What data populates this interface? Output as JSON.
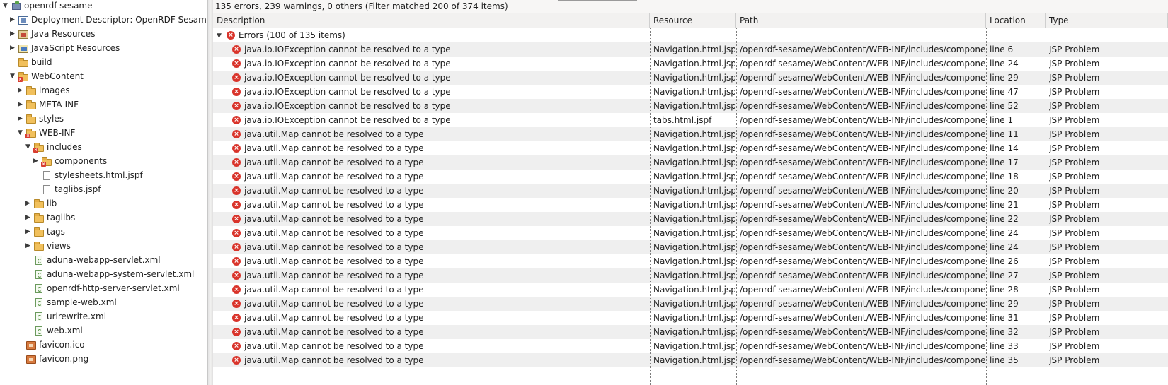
{
  "tree": {
    "items": [
      {
        "label": "openrdf-sesame",
        "icon": "project-icon",
        "toggle": "▼",
        "depth": 0
      },
      {
        "label": "Deployment Descriptor: OpenRDF Sesame",
        "icon": "deployment-descriptor-icon",
        "toggle": "▶",
        "depth": 1
      },
      {
        "label": "Java Resources",
        "icon": "java-resources-icon",
        "toggle": "▶",
        "depth": 1
      },
      {
        "label": "JavaScript Resources",
        "icon": "javascript-resources-icon",
        "toggle": "▶",
        "depth": 1
      },
      {
        "label": "build",
        "icon": "folder-icon",
        "toggle": "",
        "depth": 1
      },
      {
        "label": "WebContent",
        "icon": "folder-error-icon",
        "toggle": "▼",
        "depth": 1
      },
      {
        "label": "images",
        "icon": "folder-icon",
        "toggle": "▶",
        "depth": 2
      },
      {
        "label": "META-INF",
        "icon": "folder-icon",
        "toggle": "▶",
        "depth": 2
      },
      {
        "label": "styles",
        "icon": "folder-icon",
        "toggle": "▶",
        "depth": 2
      },
      {
        "label": "WEB-INF",
        "icon": "folder-error-icon",
        "toggle": "▼",
        "depth": 2
      },
      {
        "label": "includes",
        "icon": "folder-error-icon",
        "toggle": "▼",
        "depth": 3
      },
      {
        "label": "components",
        "icon": "folder-error-icon",
        "toggle": "▶",
        "depth": 4
      },
      {
        "label": "stylesheets.html.jspf",
        "icon": "file-icon",
        "toggle": "",
        "depth": 4
      },
      {
        "label": "taglibs.jspf",
        "icon": "file-icon",
        "toggle": "",
        "depth": 4
      },
      {
        "label": "lib",
        "icon": "folder-icon",
        "toggle": "▶",
        "depth": 3
      },
      {
        "label": "taglibs",
        "icon": "folder-icon",
        "toggle": "▶",
        "depth": 3
      },
      {
        "label": "tags",
        "icon": "folder-icon",
        "toggle": "▶",
        "depth": 3
      },
      {
        "label": "views",
        "icon": "folder-icon",
        "toggle": "▶",
        "depth": 3
      },
      {
        "label": "aduna-webapp-servlet.xml",
        "icon": "xml-file-icon",
        "toggle": "",
        "depth": 3
      },
      {
        "label": "aduna-webapp-system-servlet.xml",
        "icon": "xml-file-icon",
        "toggle": "",
        "depth": 3
      },
      {
        "label": "openrdf-http-server-servlet.xml",
        "icon": "xml-file-icon",
        "toggle": "",
        "depth": 3
      },
      {
        "label": "sample-web.xml",
        "icon": "xml-file-icon",
        "toggle": "",
        "depth": 3
      },
      {
        "label": "urlrewrite.xml",
        "icon": "xml-file-icon",
        "toggle": "",
        "depth": 3
      },
      {
        "label": "web.xml",
        "icon": "xml-file-icon",
        "toggle": "",
        "depth": 3
      },
      {
        "label": "favicon.ico",
        "icon": "image-file-icon",
        "toggle": "",
        "depth": 2
      },
      {
        "label": "favicon.png",
        "icon": "image-file-icon",
        "toggle": "",
        "depth": 2
      }
    ]
  },
  "problems": {
    "summary": "135 errors, 239 warnings, 0 others (Filter matched 200 of 374 items)",
    "columns": [
      "Description",
      "Resource",
      "Path",
      "Location",
      "Type"
    ],
    "group": {
      "toggle": "▼",
      "label": "Errors (100 of 135 items)"
    },
    "rows": [
      {
        "description": "java.io.IOException cannot be resolved to a type",
        "resource": "Navigation.html.jspf",
        "path": "/openrdf-sesame/WebContent/WEB-INF/includes/components",
        "location": "line 6",
        "type": "JSP Problem"
      },
      {
        "description": "java.io.IOException cannot be resolved to a type",
        "resource": "Navigation.html.jspf",
        "path": "/openrdf-sesame/WebContent/WEB-INF/includes/components",
        "location": "line 24",
        "type": "JSP Problem"
      },
      {
        "description": "java.io.IOException cannot be resolved to a type",
        "resource": "Navigation.html.jspf",
        "path": "/openrdf-sesame/WebContent/WEB-INF/includes/components",
        "location": "line 29",
        "type": "JSP Problem"
      },
      {
        "description": "java.io.IOException cannot be resolved to a type",
        "resource": "Navigation.html.jspf",
        "path": "/openrdf-sesame/WebContent/WEB-INF/includes/components",
        "location": "line 47",
        "type": "JSP Problem"
      },
      {
        "description": "java.io.IOException cannot be resolved to a type",
        "resource": "Navigation.html.jspf",
        "path": "/openrdf-sesame/WebContent/WEB-INF/includes/components",
        "location": "line 52",
        "type": "JSP Problem"
      },
      {
        "description": "java.io.IOException cannot be resolved to a type",
        "resource": "tabs.html.jspf",
        "path": "/openrdf-sesame/WebContent/WEB-INF/includes/components",
        "location": "line 1",
        "type": "JSP Problem"
      },
      {
        "description": "java.util.Map cannot be resolved to a type",
        "resource": "Navigation.html.jspf",
        "path": "/openrdf-sesame/WebContent/WEB-INF/includes/components",
        "location": "line 11",
        "type": "JSP Problem"
      },
      {
        "description": "java.util.Map cannot be resolved to a type",
        "resource": "Navigation.html.jspf",
        "path": "/openrdf-sesame/WebContent/WEB-INF/includes/components",
        "location": "line 14",
        "type": "JSP Problem"
      },
      {
        "description": "java.util.Map cannot be resolved to a type",
        "resource": "Navigation.html.jspf",
        "path": "/openrdf-sesame/WebContent/WEB-INF/includes/components",
        "location": "line 17",
        "type": "JSP Problem"
      },
      {
        "description": "java.util.Map cannot be resolved to a type",
        "resource": "Navigation.html.jspf",
        "path": "/openrdf-sesame/WebContent/WEB-INF/includes/components",
        "location": "line 18",
        "type": "JSP Problem"
      },
      {
        "description": "java.util.Map cannot be resolved to a type",
        "resource": "Navigation.html.jspf",
        "path": "/openrdf-sesame/WebContent/WEB-INF/includes/components",
        "location": "line 20",
        "type": "JSP Problem"
      },
      {
        "description": "java.util.Map cannot be resolved to a type",
        "resource": "Navigation.html.jspf",
        "path": "/openrdf-sesame/WebContent/WEB-INF/includes/components",
        "location": "line 21",
        "type": "JSP Problem"
      },
      {
        "description": "java.util.Map cannot be resolved to a type",
        "resource": "Navigation.html.jspf",
        "path": "/openrdf-sesame/WebContent/WEB-INF/includes/components",
        "location": "line 22",
        "type": "JSP Problem"
      },
      {
        "description": "java.util.Map cannot be resolved to a type",
        "resource": "Navigation.html.jspf",
        "path": "/openrdf-sesame/WebContent/WEB-INF/includes/components",
        "location": "line 24",
        "type": "JSP Problem"
      },
      {
        "description": "java.util.Map cannot be resolved to a type",
        "resource": "Navigation.html.jspf",
        "path": "/openrdf-sesame/WebContent/WEB-INF/includes/components",
        "location": "line 24",
        "type": "JSP Problem"
      },
      {
        "description": "java.util.Map cannot be resolved to a type",
        "resource": "Navigation.html.jspf",
        "path": "/openrdf-sesame/WebContent/WEB-INF/includes/components",
        "location": "line 26",
        "type": "JSP Problem"
      },
      {
        "description": "java.util.Map cannot be resolved to a type",
        "resource": "Navigation.html.jspf",
        "path": "/openrdf-sesame/WebContent/WEB-INF/includes/components",
        "location": "line 27",
        "type": "JSP Problem"
      },
      {
        "description": "java.util.Map cannot be resolved to a type",
        "resource": "Navigation.html.jspf",
        "path": "/openrdf-sesame/WebContent/WEB-INF/includes/components",
        "location": "line 28",
        "type": "JSP Problem"
      },
      {
        "description": "java.util.Map cannot be resolved to a type",
        "resource": "Navigation.html.jspf",
        "path": "/openrdf-sesame/WebContent/WEB-INF/includes/components",
        "location": "line 29",
        "type": "JSP Problem"
      },
      {
        "description": "java.util.Map cannot be resolved to a type",
        "resource": "Navigation.html.jspf",
        "path": "/openrdf-sesame/WebContent/WEB-INF/includes/components",
        "location": "line 31",
        "type": "JSP Problem"
      },
      {
        "description": "java.util.Map cannot be resolved to a type",
        "resource": "Navigation.html.jspf",
        "path": "/openrdf-sesame/WebContent/WEB-INF/includes/components",
        "location": "line 32",
        "type": "JSP Problem"
      },
      {
        "description": "java.util.Map cannot be resolved to a type",
        "resource": "Navigation.html.jspf",
        "path": "/openrdf-sesame/WebContent/WEB-INF/includes/components",
        "location": "line 33",
        "type": "JSP Problem"
      },
      {
        "description": "java.util.Map cannot be resolved to a type",
        "resource": "Navigation.html.jspf",
        "path": "/openrdf-sesame/WebContent/WEB-INF/includes/components",
        "location": "line 35",
        "type": "JSP Problem"
      }
    ]
  },
  "colors": {
    "error": "#d9342b",
    "row_alt": "#efefef",
    "folder": "#f1c05c"
  }
}
